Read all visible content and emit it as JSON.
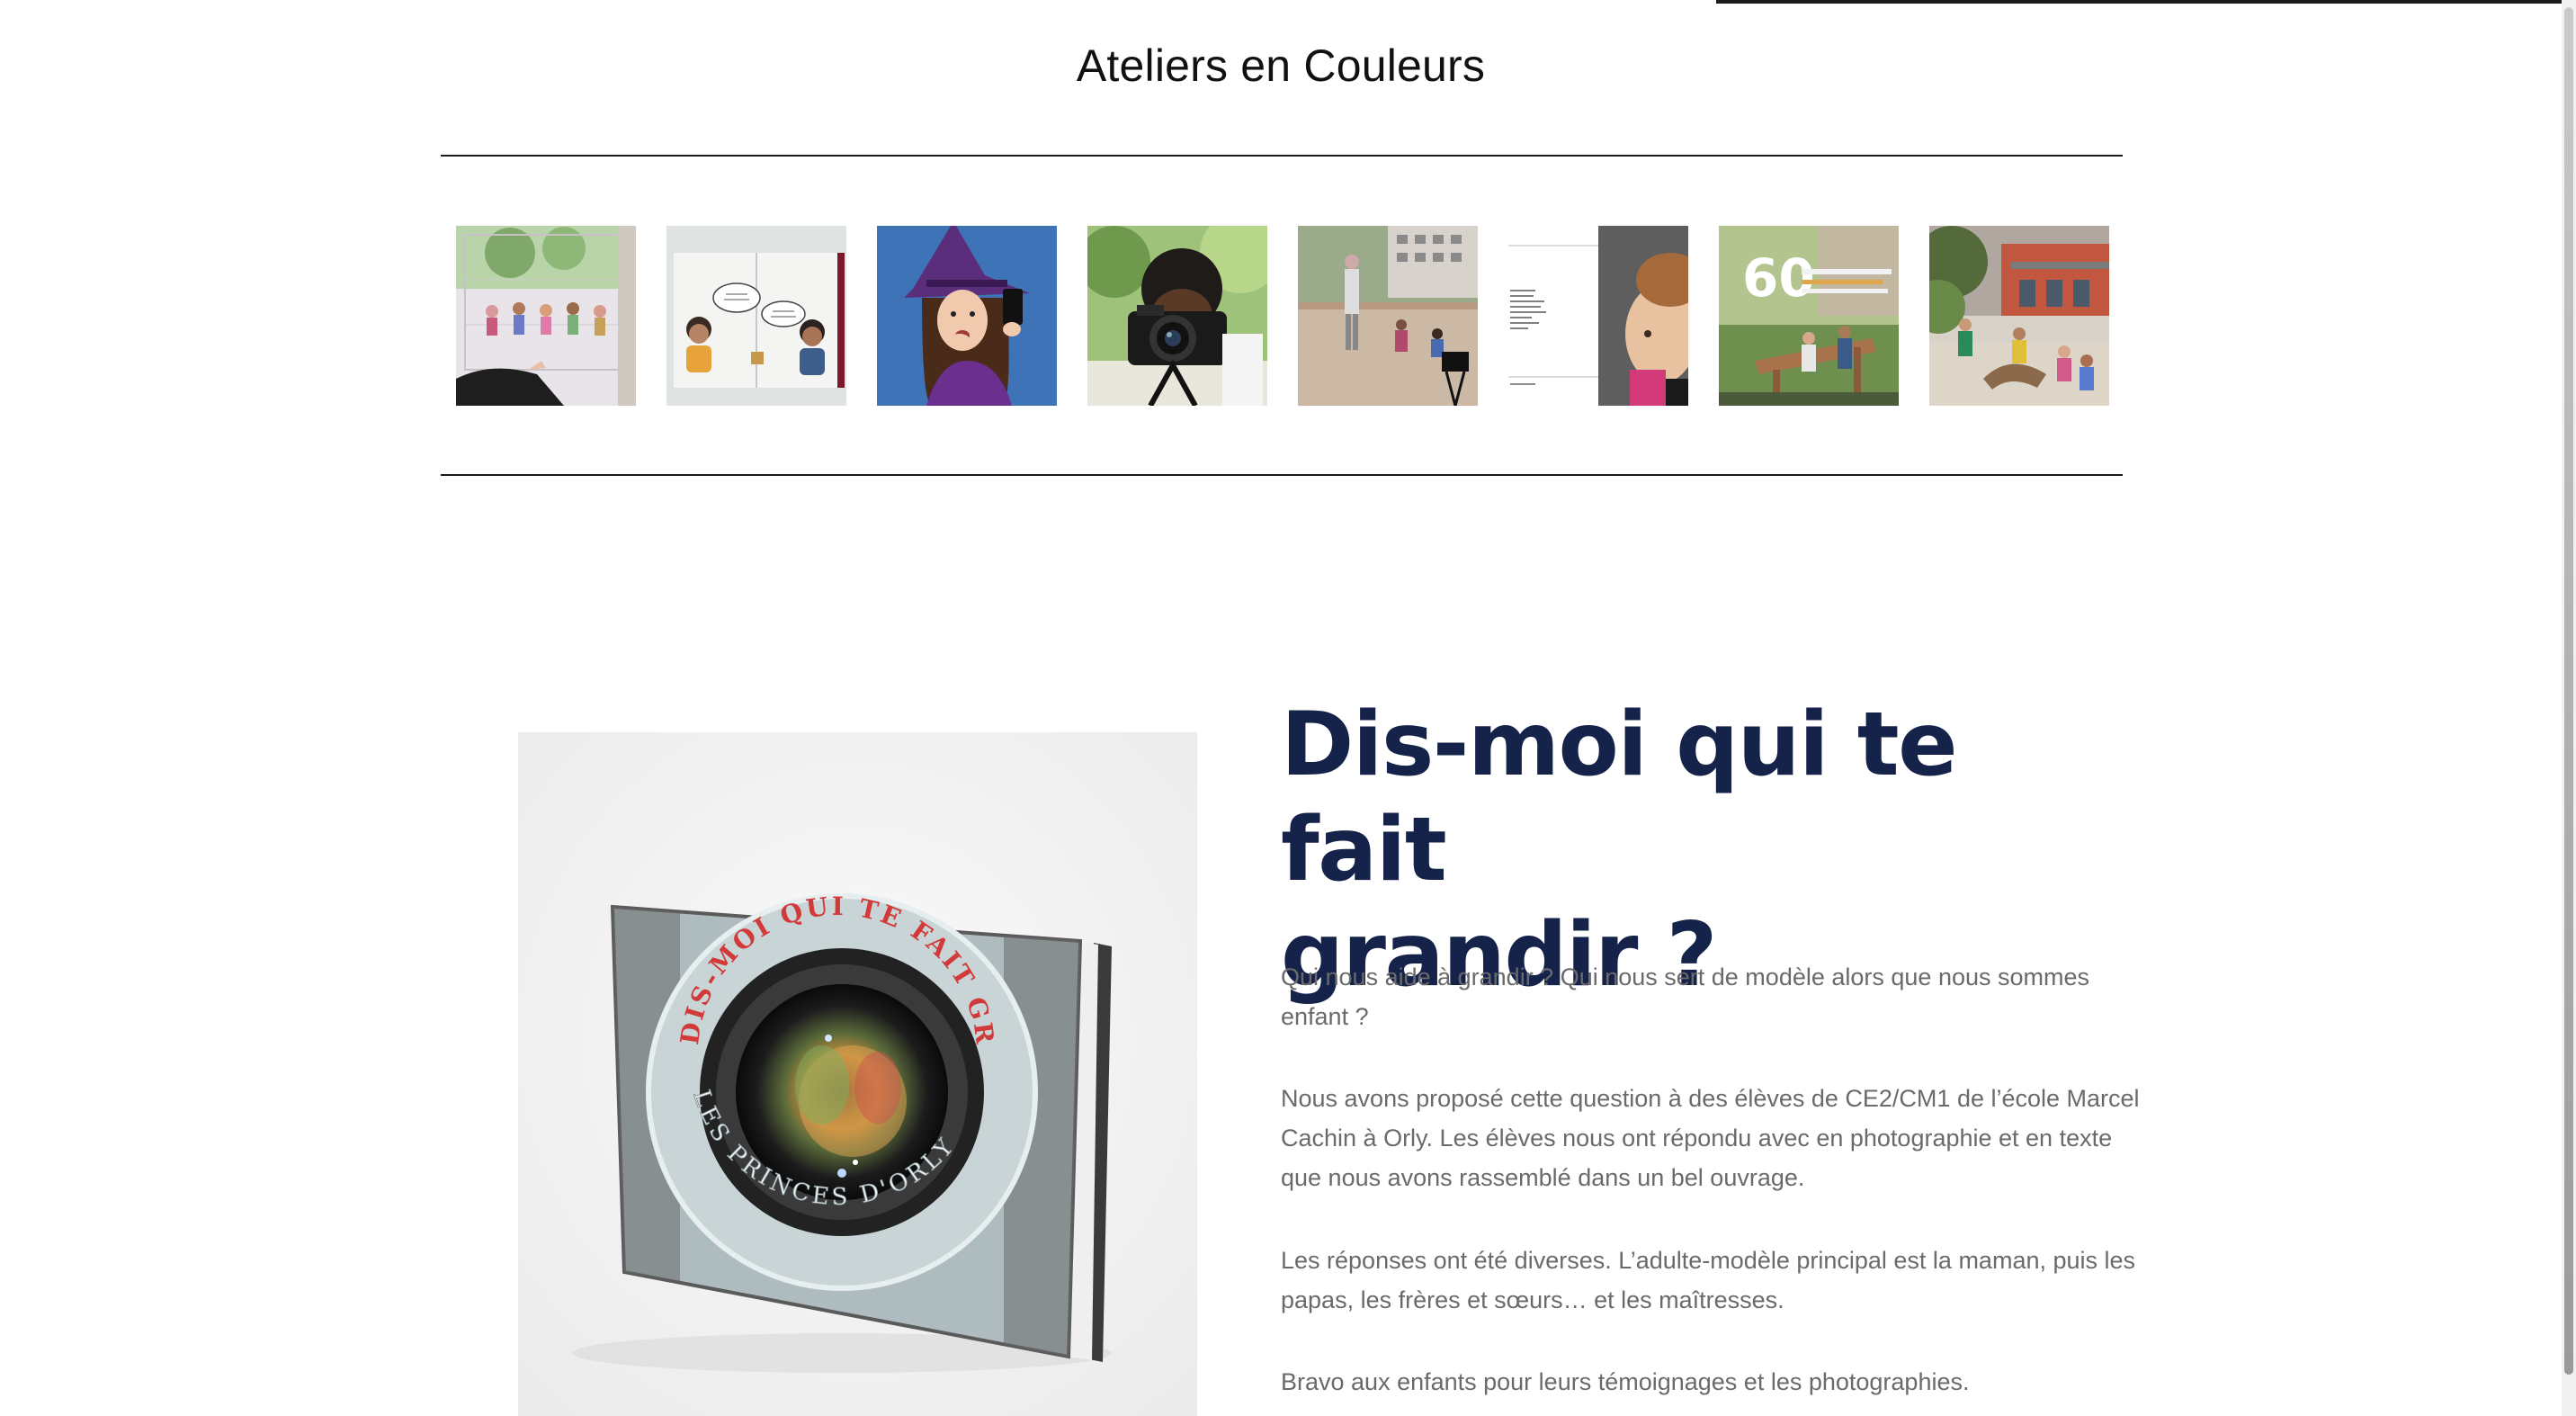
{
  "header": {
    "site_title": "Ateliers en Couleurs"
  },
  "gallery": {
    "items": [
      {
        "icon": "classroom-photo"
      },
      {
        "icon": "illustrated-book-page"
      },
      {
        "icon": "witch-portrait"
      },
      {
        "icon": "child-with-camera"
      },
      {
        "icon": "schoolyard-photo"
      },
      {
        "icon": "text-page-with-portrait"
      },
      {
        "icon": "sixty-years-poster"
      },
      {
        "icon": "children-in-park"
      }
    ]
  },
  "hero_image": {
    "book_title_line": "DIS-MOI QUI TE FAIT GRANDIR",
    "book_author_line": "LES PRINCES D'ORLY"
  },
  "article": {
    "title_line1": "Dis-moi qui te fait",
    "title_line2": "grandir ?",
    "paragraphs": {
      "p1": "Qui nous aide à grandir ? Qui nous sert de modèle alors que nous sommes enfant ?",
      "p2": "Nous avons proposé cette question à des élèves de CE2/CM1 de l’école Marcel Cachin à Orly. Les élèves nous ont répondu avec en photographie et en texte que nous avons rassemblé dans un bel ouvrage.",
      "p3": "Les réponses ont été diverses. L’adulte-modèle principal est la maman, puis les papas, les frères et sœurs… et les maîtresses.",
      "p4": "Bravo aux enfants pour leurs témoignages et les photographies."
    }
  },
  "colors": {
    "title_navy": "#15234a",
    "body_gray": "#6a6a6a",
    "book_red": "#d23a3a"
  }
}
